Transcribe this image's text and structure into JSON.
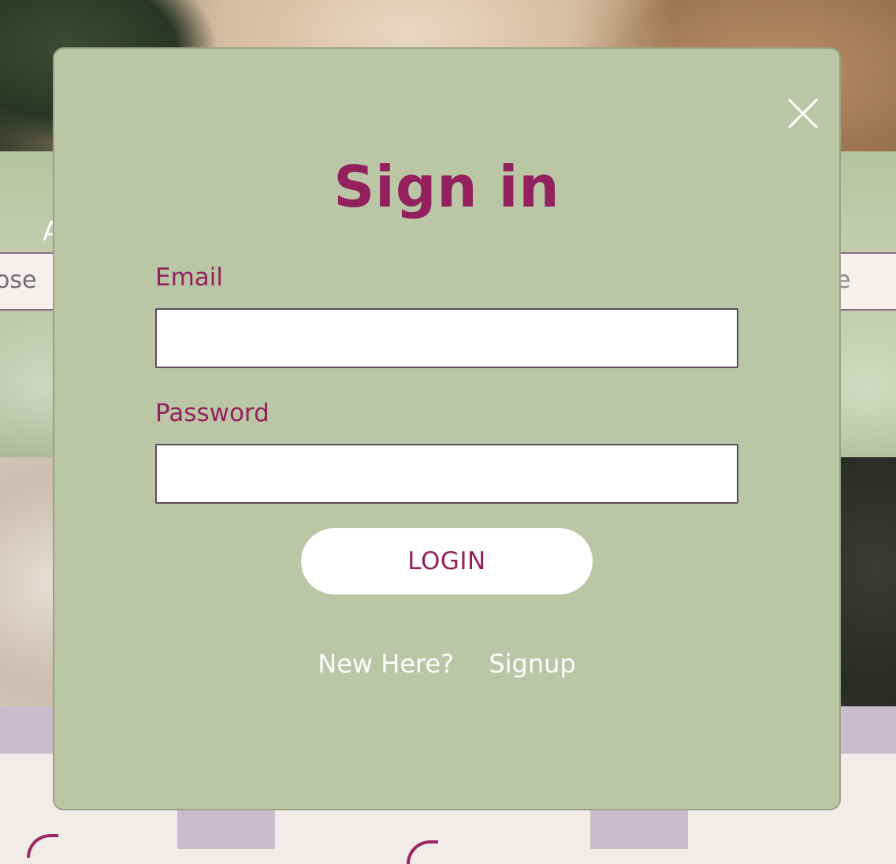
{
  "background": {
    "search_left_text": "ose",
    "search_right_text": "de",
    "hero_letter": "A"
  },
  "modal": {
    "title": "Sign in",
    "email_label": "Email",
    "email_value": "",
    "password_label": "Password",
    "password_value": "",
    "login_label": "LOGIN",
    "new_here_text": "New Here?",
    "signup_label": "Signup",
    "close_icon": "close-icon"
  },
  "colors": {
    "modal_bg": "#bac6a6",
    "accent": "#92215d",
    "input_border": "#5e4a5e",
    "band": "#c9bdcc"
  }
}
